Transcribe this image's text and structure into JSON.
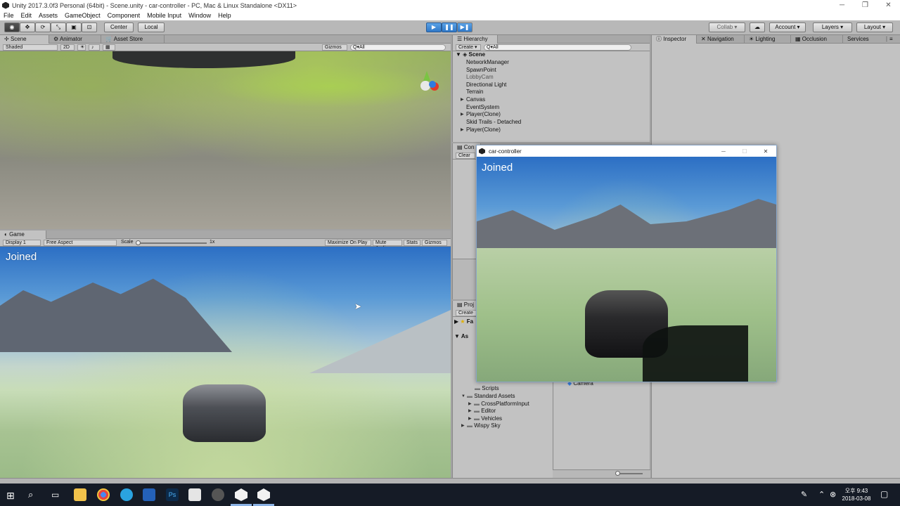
{
  "window": {
    "title": "Unity 2017.3.0f3 Personal (64bit) - Scene.unity - car-controller - PC, Mac & Linux Standalone <DX11>"
  },
  "menu": [
    "File",
    "Edit",
    "Assets",
    "GameObject",
    "Component",
    "Mobile Input",
    "Window",
    "Help"
  ],
  "toolbar": {
    "center": "Center",
    "local": "Local",
    "collab": "Collab ▾",
    "account": "Account",
    "layers": "Layers",
    "layout": "Layout"
  },
  "scene": {
    "tab": "Scene",
    "animator_tab": "Animator",
    "asset_store_tab": "Asset Store",
    "shading": "Shaded",
    "mode_2d": "2D",
    "gizmos": "Gizmos",
    "search": "Q▾All"
  },
  "game": {
    "tab": "Game",
    "display": "Display 1",
    "aspect": "Free Aspect",
    "scale_label": "Scale",
    "scale_value": "1x",
    "maximize": "Maximize On Play",
    "mute": "Mute Audio",
    "stats": "Stats",
    "gizmos": "Gizmos",
    "overlay": "Joined"
  },
  "hierarchy": {
    "tab": "Hierarchy",
    "create": "Create ▾",
    "search": "Q▾All",
    "scene": "Scene",
    "items": [
      {
        "label": "NetworkManager",
        "arrow": ""
      },
      {
        "label": "SpawnPoint",
        "arrow": ""
      },
      {
        "label": "LobbyCam",
        "arrow": ""
      },
      {
        "label": "Directional Light",
        "arrow": ""
      },
      {
        "label": "Terrain",
        "arrow": ""
      },
      {
        "label": "Canvas",
        "arrow": "▶"
      },
      {
        "label": "EventSystem",
        "arrow": ""
      },
      {
        "label": "Player(Clone)",
        "arrow": "▶"
      },
      {
        "label": "Skid Trails - Detached",
        "arrow": ""
      },
      {
        "label": "Player(Clone)",
        "arrow": "▶"
      }
    ]
  },
  "console": {
    "tab": "Con",
    "clear": "Clear"
  },
  "project": {
    "tab": "Proj",
    "create": "Create",
    "favorites": "Fa",
    "assets": "As",
    "items": [
      {
        "label": "Scripts",
        "arrow": "",
        "indent": 1
      },
      {
        "label": "Standard Assets",
        "arrow": "▼",
        "indent": 1
      },
      {
        "label": "CrossPlatformInput",
        "arrow": "▶",
        "indent": 2
      },
      {
        "label": "Editor",
        "arrow": "▶",
        "indent": 2
      },
      {
        "label": "Vehicles",
        "arrow": "▶",
        "indent": 2
      },
      {
        "label": "Wispy Sky",
        "arrow": "▶",
        "indent": 1
      }
    ],
    "camera": "Camera"
  },
  "inspector": {
    "tabs": [
      "Inspector",
      "Navigation",
      "Lighting",
      "Occlusion",
      "Services"
    ]
  },
  "player_window": {
    "title": "car-controller",
    "overlay": "Joined"
  },
  "taskbar": {
    "time": "오후 9:43",
    "date": "2018-03-08"
  }
}
